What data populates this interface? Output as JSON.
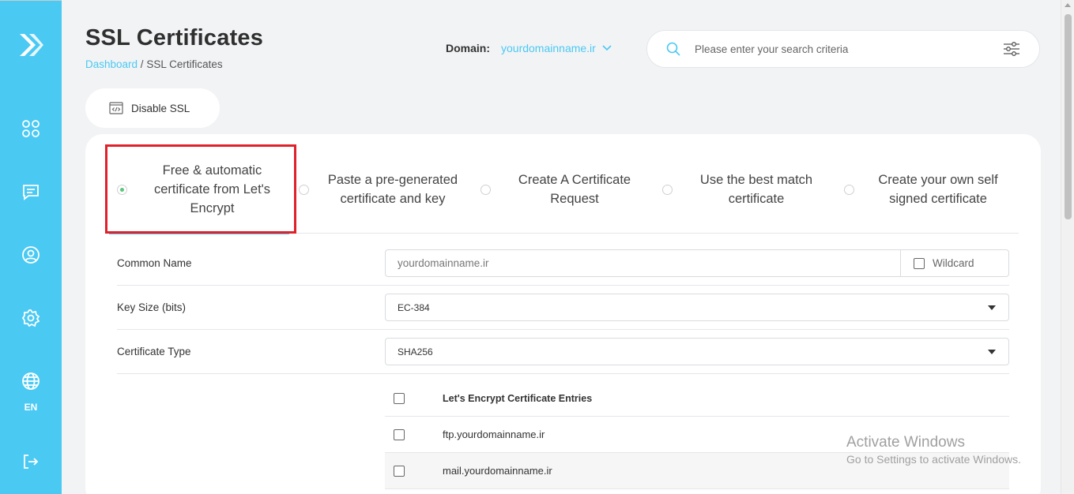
{
  "sidebar": {
    "lang_label": "EN",
    "icons": [
      "logo-icon",
      "apps-grid-icon",
      "message-icon",
      "user-icon",
      "settings-icon",
      "globe-icon",
      "logout-icon"
    ],
    "accent": "#4ac9f3"
  },
  "header": {
    "title": "SSL Certificates",
    "breadcrumb_home": "Dashboard",
    "breadcrumb_sep": " / ",
    "breadcrumb_current": "SSL Certificates",
    "domain_label": "Domain:",
    "domain_value": "yourdomainname.ir",
    "search_placeholder": "Please enter your search criteria"
  },
  "actions": {
    "disable_ssl": "Disable SSL"
  },
  "tabs": [
    {
      "label": "Free & automatic certificate from Let's Encrypt",
      "selected": true
    },
    {
      "label": "Paste a pre-generated certificate and key",
      "selected": false
    },
    {
      "label": "Create A Certificate Request",
      "selected": false
    },
    {
      "label": "Use the best match certificate",
      "selected": false
    },
    {
      "label": "Create your own self signed certificate",
      "selected": false
    }
  ],
  "form": {
    "common_name_label": "Common Name",
    "common_name_placeholder": "yourdomainname.ir",
    "wildcard_label": "Wildcard",
    "key_size_label": "Key Size (bits)",
    "key_size_value": "EC-384",
    "cert_type_label": "Certificate Type",
    "cert_type_value": "SHA256"
  },
  "entries": {
    "header": "Let's Encrypt Certificate Entries",
    "rows": [
      "ftp.yourdomainname.ir",
      "mail.yourdomainname.ir"
    ]
  },
  "watermark": {
    "line1": "Activate Windows",
    "line2": "Go to Settings to activate Windows."
  },
  "colors": {
    "accent": "#4ac9f3",
    "selected_radio": "#5cc67f",
    "highlight_border": "#e0202a"
  }
}
